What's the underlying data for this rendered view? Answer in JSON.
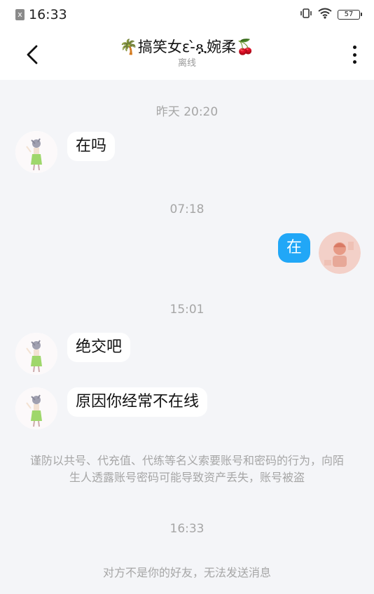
{
  "status_bar": {
    "time": "16:33",
    "battery": "57",
    "sim_icon": "x"
  },
  "header": {
    "title": "🌴搞笑女ε-̀ጿ婉柔🍒",
    "subtitle": "离线"
  },
  "messages": [
    {
      "time": "昨天 20:20"
    },
    {
      "sender": "other",
      "text": "在吗"
    },
    {
      "time": "07:18"
    },
    {
      "sender": "self",
      "text": "在"
    },
    {
      "time": "15:01"
    },
    {
      "sender": "other",
      "text": "绝交吧"
    },
    {
      "sender": "other",
      "text": "原因你经常不在线"
    }
  ],
  "chat": {
    "ts1": "昨天 20:20",
    "msg1": "在吗",
    "ts2": "07:18",
    "msg2": "在",
    "ts3": "15:01",
    "msg3": "绝交吧",
    "msg4": "原因你经常不在线",
    "notice": "谨防以共号、代充值、代练等名义索要账号和密码的行为，向陌生人透露账号密码可能导致资产丢失，账号被盗",
    "ts4": "16:33",
    "footer": "对方不是你的好友，无法发送消息"
  },
  "colors": {
    "background": "#f4f5f8",
    "self_bubble": "#21a7f7",
    "other_bubble": "#ffffff",
    "muted_text": "#a6a6a6"
  },
  "icons": {
    "back": "back-arrow-icon",
    "more": "more-vertical-icon",
    "vibrate": "vibrate-icon",
    "wifi": "wifi-icon",
    "battery": "battery-icon"
  }
}
